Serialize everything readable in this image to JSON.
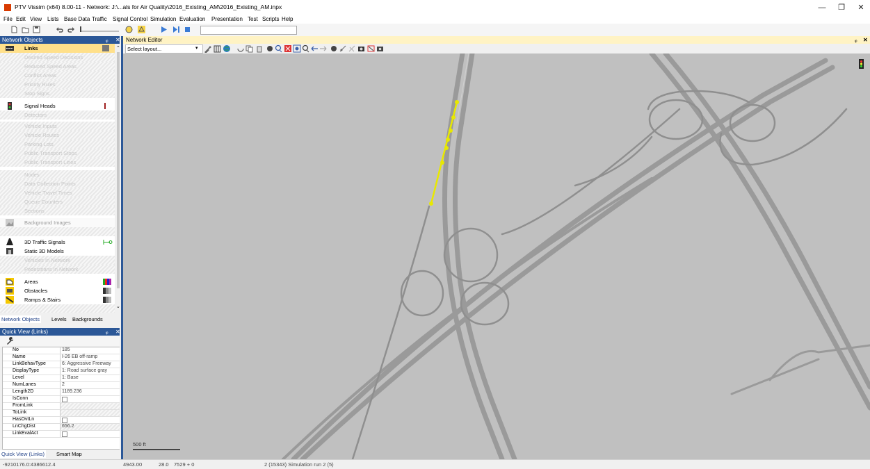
{
  "window": {
    "title": "PTV Vissim (x64) 8.00-11 - Network: J:\\...als for Air Quality\\2016_Existing_AM\\2016_Existing_AM.inpx",
    "minimize": "—",
    "maximize": "❐",
    "close": "✕"
  },
  "menu": [
    "File",
    "Edit",
    "View",
    "Lists",
    "Base Data",
    "Traffic",
    "Signal Control",
    "Simulation",
    "Evaluation",
    "Presentation",
    "Test",
    "Scripts",
    "Help"
  ],
  "network_objects": {
    "header": "Network Objects",
    "pin": "ᵩ",
    "close": "✕",
    "items": [
      {
        "label": "Links",
        "state": "selected",
        "icon": "links-icon"
      },
      {
        "label": "Desired Speed Decisions",
        "state": "faded"
      },
      {
        "label": "Reduced Speed Areas",
        "state": "faded"
      },
      {
        "label": "Conflict Areas",
        "state": "faded"
      },
      {
        "label": "Priority Rules",
        "state": "faded"
      },
      {
        "label": "Stop Signs",
        "state": "faded"
      },
      {
        "label": "Signal Heads",
        "state": "active",
        "icon": "signal-head-icon"
      },
      {
        "label": "Detectors",
        "state": "faded"
      },
      {
        "label": "Vehicle Inputs",
        "state": "faded"
      },
      {
        "label": "Vehicle Routes",
        "state": "faded"
      },
      {
        "label": "Parking Lots",
        "state": "faded"
      },
      {
        "label": "Public Transport Stops",
        "state": "faded"
      },
      {
        "label": "Public Transport Lines",
        "state": "faded"
      },
      {
        "label": "Nodes",
        "state": "faded"
      },
      {
        "label": "Data Collection Points",
        "state": "faded"
      },
      {
        "label": "Vehicle Travel Times",
        "state": "faded"
      },
      {
        "label": "Queue Counters",
        "state": "faded"
      },
      {
        "label": "Sections",
        "state": "faded"
      },
      {
        "label": "Background Images",
        "state": "semi",
        "icon": "background-images-icon"
      },
      {
        "label": "",
        "state": "hatch"
      },
      {
        "label": "3D Traffic Signals",
        "state": "active",
        "icon": "traffic-signal-3d-icon"
      },
      {
        "label": "Static 3D Models",
        "state": "active",
        "icon": "static-model-icon"
      },
      {
        "label": "Vehicles In Network",
        "state": "faded"
      },
      {
        "label": "Pedestrians In Network",
        "state": "faded"
      },
      {
        "label": "Areas",
        "state": "active",
        "icon": "areas-icon"
      },
      {
        "label": "Obstacles",
        "state": "active",
        "icon": "obstacles-icon"
      },
      {
        "label": "Ramps & Stairs",
        "state": "active",
        "icon": "ramps-icon"
      }
    ],
    "tabs": [
      "Network Objects",
      "Levels",
      "Backgrounds"
    ]
  },
  "quick_view": {
    "header": "Quick View (Links)",
    "pin": "ᵩ",
    "close": "✕",
    "rows": [
      {
        "key": "No",
        "value": "185"
      },
      {
        "key": "Name",
        "value": "I-26 EB off-ramp"
      },
      {
        "key": "LinkBehavType",
        "value": "6: Aggressive Freeway"
      },
      {
        "key": "DisplayType",
        "value": "1: Road surface gray"
      },
      {
        "key": "Level",
        "value": "1: Base"
      },
      {
        "key": "NumLanes",
        "value": "2"
      },
      {
        "key": "Length2D",
        "value": "1189.236"
      },
      {
        "key": "IsConn",
        "value": "",
        "type": "checkbox"
      },
      {
        "key": "FromLink",
        "value": "",
        "type": "hatch"
      },
      {
        "key": "ToLink",
        "value": "",
        "type": "hatch"
      },
      {
        "key": "HasOvtLn",
        "value": "",
        "type": "checkbox"
      },
      {
        "key": "LnChgDist",
        "value": "656.2",
        "type": "hatchval"
      },
      {
        "key": "LinkEvalAct",
        "value": "",
        "type": "checkbox"
      }
    ],
    "tabs": [
      "Quick View (Links)",
      "Smart Map"
    ]
  },
  "editor": {
    "header": "Network Editor",
    "pin": "ᵩ",
    "close": "✕",
    "layout_placeholder": "Select layout...",
    "scale_label": "500 ft"
  },
  "status": {
    "coords": "-9210176.0:4386612.4",
    "sim_time": "4943.00",
    "speed": "28.0",
    "step": "7529 + 0",
    "run": "2 (15343) Simulation run 2 (5)"
  },
  "colors": {
    "panel_header": "#2b5797",
    "editor_header": "#fff3c4",
    "canvas": "#c0c0c0",
    "road": "#9a9a9a",
    "selected_link": "#e8e800"
  }
}
